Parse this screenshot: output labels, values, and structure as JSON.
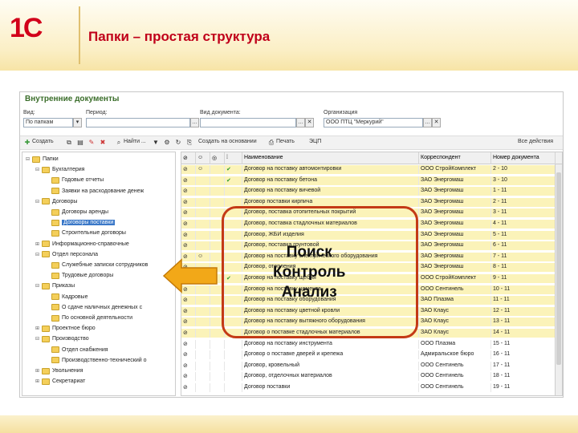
{
  "slide": {
    "title": "Папки – простая структура",
    "logo": "1С"
  },
  "window": {
    "title": "Внутренние документы",
    "filters": {
      "view_label": "Вид:",
      "view_value": "По папкам",
      "period_label": "Период:",
      "period_value": "",
      "doctype_label": "Вид документа:",
      "doctype_value": "",
      "org_label": "Организация",
      "org_value": "ООО ПТЦ \"Меркурий\""
    },
    "toolbar": {
      "create": "Создать",
      "find": "Найти ...",
      "create_basis": "Создать на основании",
      "print": "Печать",
      "ecp": "ЭЦП",
      "all_actions": "Все действия"
    },
    "tree": [
      {
        "label": "Папки",
        "level": 0,
        "exp": "⊟"
      },
      {
        "label": "Бухгалтерия",
        "level": 1,
        "exp": "⊟"
      },
      {
        "label": "Годовые отчеты",
        "level": 2,
        "exp": ""
      },
      {
        "label": "Заявки на расходование денеж",
        "level": 2,
        "exp": ""
      },
      {
        "label": "Договоры",
        "level": 1,
        "exp": "⊟"
      },
      {
        "label": "Договоры аренды",
        "level": 2,
        "exp": ""
      },
      {
        "label": "Договоры поставки",
        "level": 2,
        "exp": "",
        "selected": true
      },
      {
        "label": "Строительные договоры",
        "level": 2,
        "exp": ""
      },
      {
        "label": "Информационно-справочные",
        "level": 1,
        "exp": "⊞"
      },
      {
        "label": "Отдел персонала",
        "level": 1,
        "exp": "⊟"
      },
      {
        "label": "Служебные записки сотрудников",
        "level": 2,
        "exp": ""
      },
      {
        "label": "Трудовые договоры",
        "level": 2,
        "exp": ""
      },
      {
        "label": "Приказы",
        "level": 1,
        "exp": "⊟"
      },
      {
        "label": "Кадровые",
        "level": 2,
        "exp": ""
      },
      {
        "label": "О сдаче наличных денежных с",
        "level": 2,
        "exp": ""
      },
      {
        "label": "По основной деятельности",
        "level": 2,
        "exp": ""
      },
      {
        "label": "Проектное бюро",
        "level": 1,
        "exp": "⊞"
      },
      {
        "label": "Производство",
        "level": 1,
        "exp": "⊟"
      },
      {
        "label": "Отдел снабжения",
        "level": 2,
        "exp": ""
      },
      {
        "label": "Производственно-технический о",
        "level": 2,
        "exp": ""
      },
      {
        "label": "Увольнения",
        "level": 1,
        "exp": "⊞"
      },
      {
        "label": "Секретариат",
        "level": 1,
        "exp": "⊞"
      }
    ],
    "grid": {
      "headers": [
        "Наименование",
        "Корреспондент",
        "Номер документа"
      ],
      "rows": [
        {
          "name": "Договор на поставку автомонтировки",
          "corr": "ООО СтройКомплект",
          "num": "2 - 10",
          "check": "✔",
          "hl": true
        },
        {
          "name": "Договор на поставку бетона",
          "corr": "ЗАО Энергомаш",
          "num": "3 - 10",
          "check": "✔",
          "hl": true
        },
        {
          "name": "Договор на поставку вичевой",
          "corr": "ЗАО Энергомаш",
          "num": "1 - 11",
          "check": "",
          "hl": true
        },
        {
          "name": "Договор поставки кирпича",
          "corr": "ЗАО Энергомаш",
          "num": "2 - 11",
          "check": "",
          "hl": true
        },
        {
          "name": "Договор, поставка отопительных покрытий",
          "corr": "ЗАО Энергомаш",
          "num": "3 - 11",
          "check": "",
          "hl": true
        },
        {
          "name": "Договор, поставка стадлочных материалов",
          "corr": "ЗАО Энергомаш",
          "num": "4 - 11",
          "check": "",
          "hl": true
        },
        {
          "name": "Договор, ЖБИ изделия",
          "corr": "ЗАО Энергомаш",
          "num": "5 - 11",
          "check": "",
          "hl": true
        },
        {
          "name": "Договор, поставка грунтовой",
          "corr": "ЗАО Энергомаш",
          "num": "6 - 11",
          "check": "",
          "hl": true
        },
        {
          "name": "Договор на поставку электрического оборудования",
          "corr": "ЗАО Энергомаш",
          "num": "7 - 11",
          "check": "",
          "hl": true
        },
        {
          "name": "Договор, отопления",
          "corr": "ЗАО Энергомаш",
          "num": "8 - 11",
          "check": "",
          "hl": true
        },
        {
          "name": "Договор на поставку щебня",
          "corr": "ООО СтройКомплект",
          "num": "9 - 11",
          "check": "✔",
          "hl": true
        },
        {
          "name": "Договор на поставку цемента",
          "corr": "ООО Сентинель",
          "num": "10 - 11",
          "check": "",
          "hl": true
        },
        {
          "name": "Договор на поставку оборудования",
          "corr": "ЗАО Плазма",
          "num": "11 - 11",
          "check": "",
          "hl": true
        },
        {
          "name": "Договор на поставку цветной кровли",
          "corr": "ЗАО Клаус",
          "num": "12 - 11",
          "check": "",
          "hl": true
        },
        {
          "name": "Договор на поставку вытяжного оборудования",
          "corr": "ЗАО Клаус",
          "num": "13 - 11",
          "check": "",
          "hl": true
        },
        {
          "name": "Договор о поставке стадлочных материалов",
          "corr": "ЗАО Клаус",
          "num": "14 - 11",
          "check": "",
          "hl": true
        },
        {
          "name": "Договор на поставку инструмента",
          "corr": "ООО Плазма",
          "num": "15 - 11",
          "check": "",
          "hl": false
        },
        {
          "name": "Договор о поставке дверей и крепежа",
          "corr": "Адмиральское бюро",
          "num": "16 - 11",
          "check": "",
          "hl": false
        },
        {
          "name": "Договор, кровельный",
          "corr": "ООО Сентинель",
          "num": "17 - 11",
          "check": "",
          "hl": false
        },
        {
          "name": "Договор, отделочных материалов",
          "corr": "ООО Сентинель",
          "num": "18 - 11",
          "check": "",
          "hl": false
        },
        {
          "name": "Договор поставки",
          "corr": "ООО Сентинель",
          "num": "19 - 11",
          "check": "",
          "hl": false
        }
      ]
    }
  },
  "callout": {
    "lines": [
      "Поиск",
      "Контроль",
      "Анализ"
    ]
  },
  "colors": {
    "title": "#c0001a",
    "callout_border": "#c43a16",
    "arrow": "#f2a818",
    "highlight": "#fbf3b9"
  }
}
